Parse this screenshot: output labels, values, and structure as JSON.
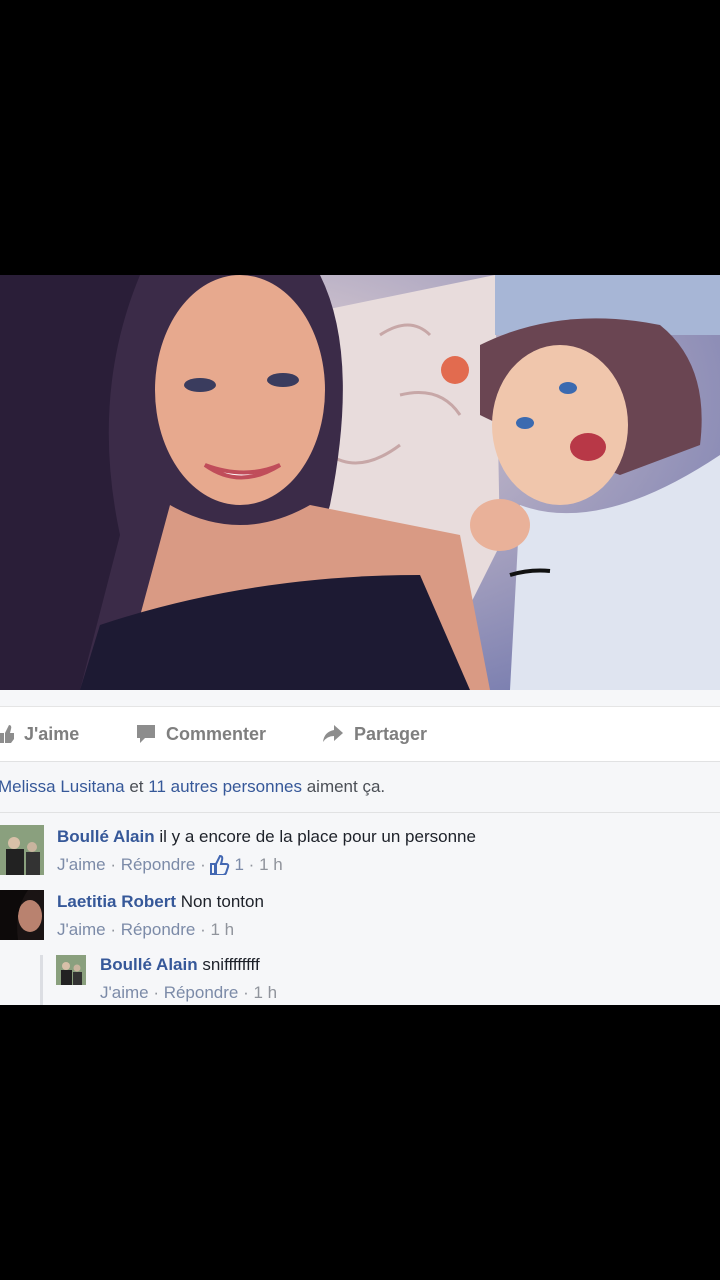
{
  "colors": {
    "link": "#365899",
    "muted": "#90949c",
    "action": "#7f7f7f",
    "panel_bg": "#f6f7f9"
  },
  "photo": {
    "alt": "selfie of two women lying on a pillow"
  },
  "actions": {
    "like": {
      "label": "J'aime",
      "icon": "thumbs-up-icon"
    },
    "comment": {
      "label": "Commenter",
      "icon": "comment-icon"
    },
    "share": {
      "label": "Partager",
      "icon": "share-arrow-icon"
    }
  },
  "likes_summary": {
    "name": "Melissa Lusitana",
    "conj": " et ",
    "others": "11 autres personnes",
    "suffix": " aiment ça."
  },
  "comments": [
    {
      "author": "Boullé Alain",
      "text": " il y a encore de la place pour un personne",
      "like": "J'aime",
      "sep": " · ",
      "reply": "Répondre",
      "like_count": "1",
      "time": "1 h"
    },
    {
      "author": "Laetitia Robert",
      "text": " Non tonton",
      "like": "J'aime",
      "sep": " · ",
      "reply": "Répondre",
      "time": "1 h"
    }
  ],
  "replies": [
    {
      "author": "Boullé Alain",
      "text": " sniffffffff",
      "like": "J'aime",
      "sep": " · ",
      "reply": "Répondre",
      "time": "1 h"
    }
  ]
}
